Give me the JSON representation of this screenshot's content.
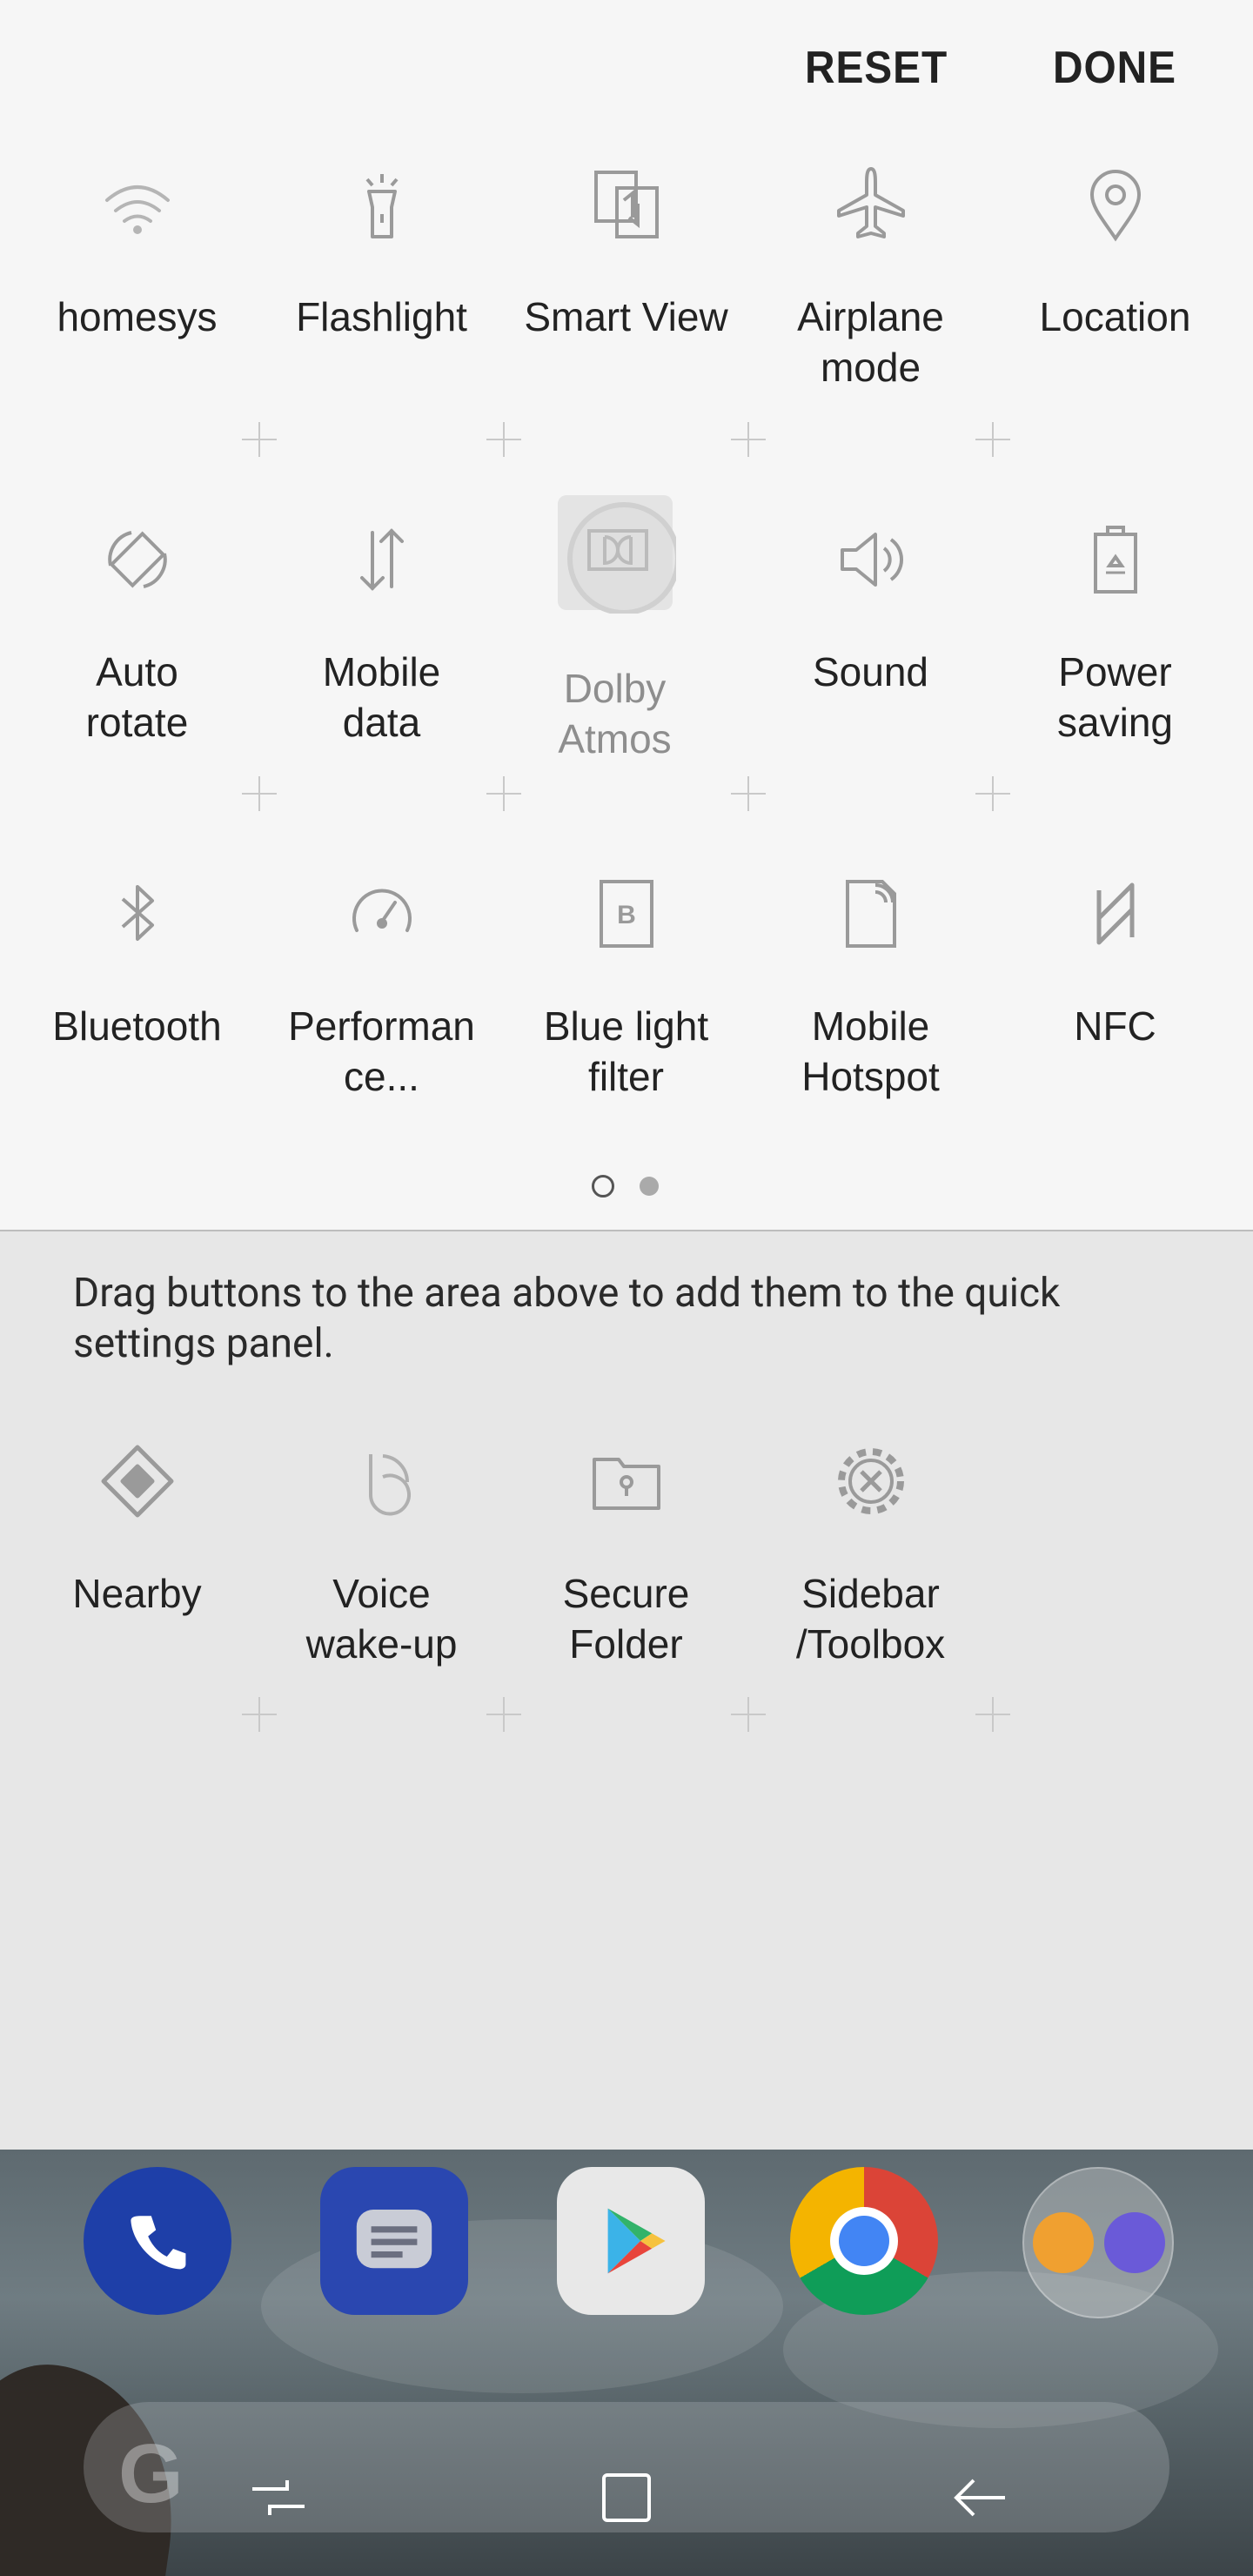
{
  "header": {
    "reset_label": "RESET",
    "done_label": "DONE"
  },
  "active_tiles": [
    {
      "label": "homesys",
      "icon": "wifi-icon"
    },
    {
      "label": "Flashlight",
      "icon": "flashlight-icon"
    },
    {
      "label": "Smart View",
      "icon": "smart-view-icon"
    },
    {
      "label": "Airplane\nmode",
      "icon": "airplane-icon"
    },
    {
      "label": "Location",
      "icon": "location-icon"
    },
    {
      "label": "Auto\nrotate",
      "icon": "auto-rotate-icon"
    },
    {
      "label": "Mobile\ndata",
      "icon": "mobile-data-icon"
    },
    {
      "label": "Dolby\nAtmos",
      "icon": "dolby-icon"
    },
    {
      "label": "Sound",
      "icon": "sound-icon"
    },
    {
      "label": "Power\nsaving",
      "icon": "power-saving-icon"
    },
    {
      "label": "Bluetooth",
      "icon": "bluetooth-icon"
    },
    {
      "label": "Performan\nce...",
      "icon": "performance-icon"
    },
    {
      "label": "Blue light\nfilter",
      "icon": "blue-light-icon"
    },
    {
      "label": "Mobile\nHotspot",
      "icon": "hotspot-icon"
    },
    {
      "label": "NFC",
      "icon": "nfc-icon"
    }
  ],
  "pager": {
    "current_page": 1,
    "total_pages": 2
  },
  "tray": {
    "hint": "Drag buttons to the area above to add them to the quick settings panel.",
    "tiles": [
      {
        "label": "Nearby",
        "icon": "nearby-icon"
      },
      {
        "label": "Voice\nwake-up",
        "icon": "voice-wakeup-icon"
      },
      {
        "label": "Secure\nFolder",
        "icon": "secure-folder-icon"
      },
      {
        "label": "Sidebar\n/Toolbox",
        "icon": "toolbox-icon"
      }
    ]
  },
  "dock": {
    "apps": [
      "phone-icon",
      "messages-icon",
      "play-store-icon",
      "chrome-icon",
      "folder-icon"
    ]
  },
  "navbar": {
    "buttons": [
      "recents-icon",
      "home-icon",
      "back-icon"
    ]
  },
  "colors": {
    "panel_bg": "#f6f6f6",
    "tray_bg": "#e7e7e7",
    "icon_gray": "#9a9a9a",
    "phone_blue": "#1e3fa8"
  }
}
